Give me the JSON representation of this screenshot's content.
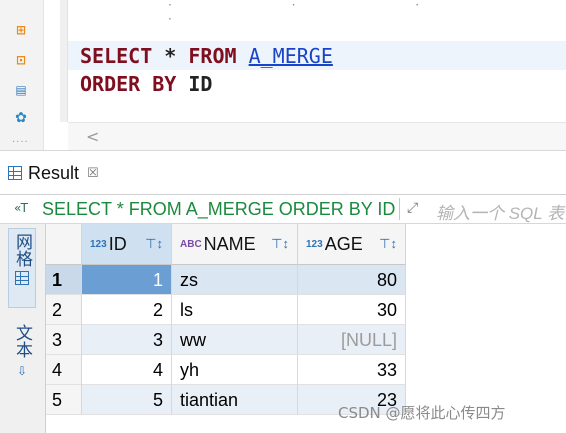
{
  "editor": {
    "sql_line1": {
      "kw_select": "SELECT",
      "star": " * ",
      "kw_from": "FROM",
      "table": "A_MERGE"
    },
    "sql_line2": {
      "kw_order_by": "ORDER BY",
      "column": "ID"
    },
    "top_dots": "· · · ·"
  },
  "toolbar": {
    "icons": [
      "execute-script-icon",
      "export-icon",
      "explain-icon",
      "settings-icon"
    ],
    "more": "····"
  },
  "scrollbar": {
    "arrow": "<"
  },
  "result_tab": {
    "label": "Result",
    "close": "☒"
  },
  "query_bar": {
    "icon": "«T",
    "text": "SELECT * FROM A_MERGE ORDER BY ID",
    "expand": "⤢",
    "filter_placeholder": "输入一个 SQL 表"
  },
  "side_tabs": {
    "grid": "网格",
    "text": "文本"
  },
  "table": {
    "columns": [
      {
        "type_icon": "123",
        "label": "ID"
      },
      {
        "type_icon": "ABC",
        "label": "NAME"
      },
      {
        "type_icon": "123",
        "label": "AGE"
      }
    ],
    "rows": [
      {
        "rownum": "1",
        "id": "1",
        "name": "zs",
        "age": "80"
      },
      {
        "rownum": "2",
        "id": "2",
        "name": "ls",
        "age": "30"
      },
      {
        "rownum": "3",
        "id": "3",
        "name": "ww",
        "age": "[NULL]"
      },
      {
        "rownum": "4",
        "id": "4",
        "name": "yh",
        "age": "33"
      },
      {
        "rownum": "5",
        "id": "5",
        "name": "tiantian",
        "age": "23"
      }
    ]
  },
  "watermark": "CSDN @愿将此心传四方",
  "colors": {
    "keyword": "#7f0e1e",
    "table_link": "#1a44c8",
    "query_text": "#1c8a3e",
    "selection": "#6b9fd3"
  }
}
